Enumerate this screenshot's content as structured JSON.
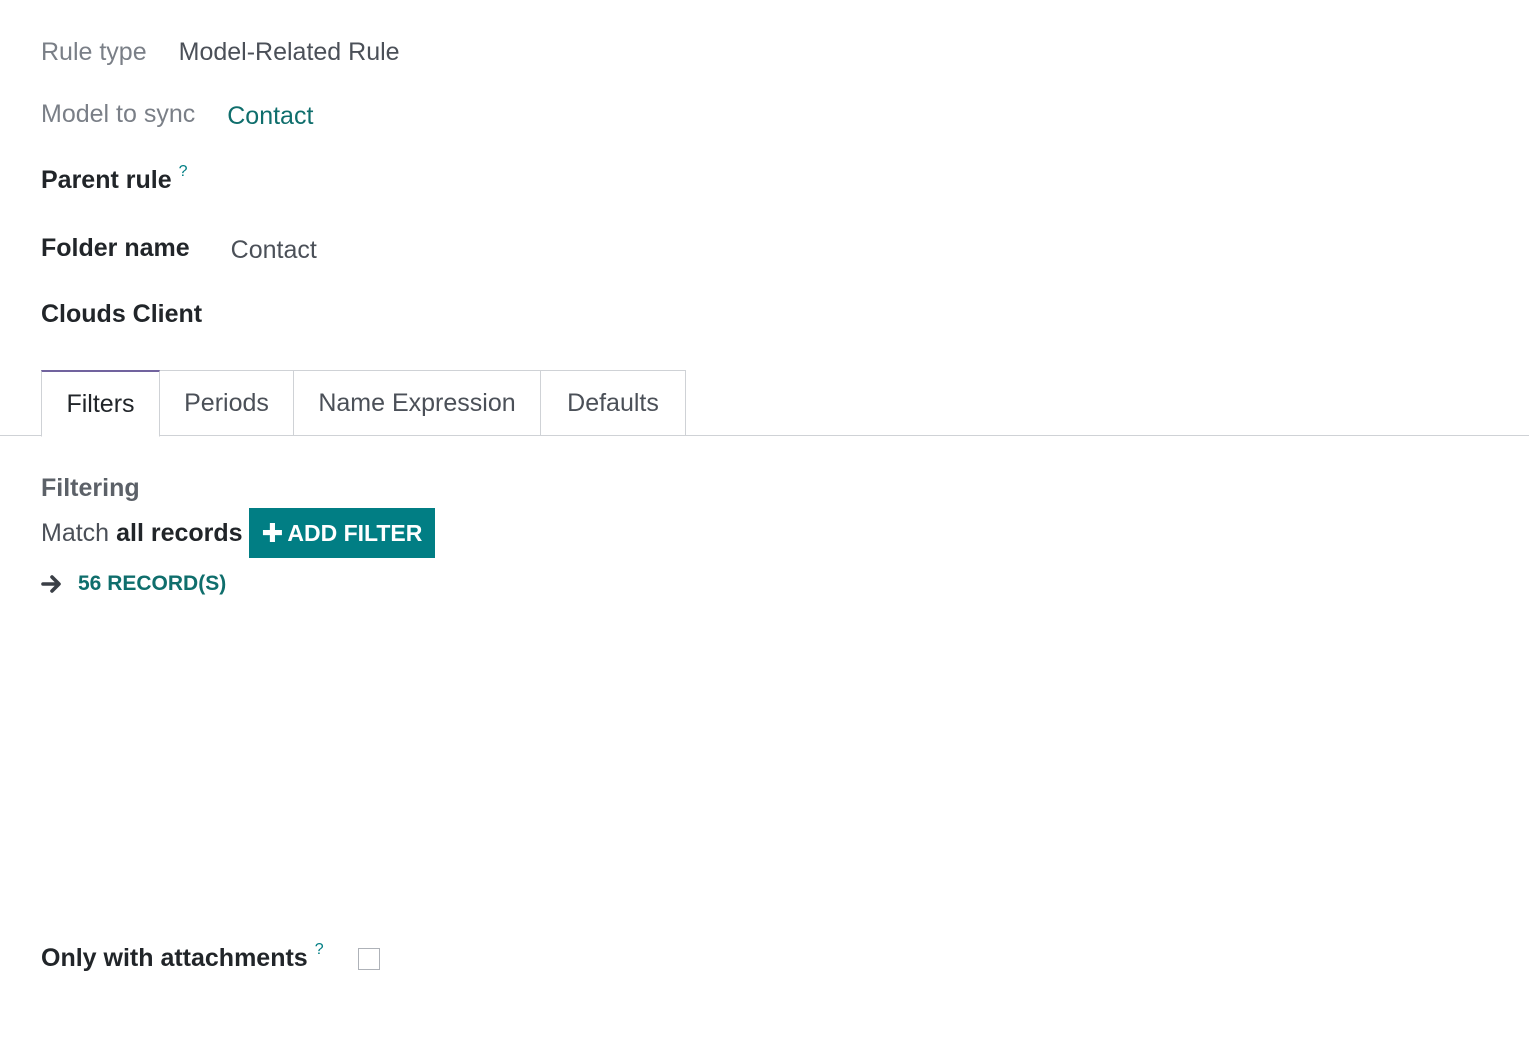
{
  "fields": {
    "rule_type": {
      "label": "Rule type",
      "value": "Model-Related Rule"
    },
    "model_to_sync": {
      "label": "Model to sync",
      "value": "Contact"
    },
    "parent_rule": {
      "label": "Parent rule",
      "help": "?"
    },
    "folder_name": {
      "label": "Folder name",
      "value": "Contact"
    },
    "clouds_client": {
      "label": "Clouds Client"
    }
  },
  "tabs": [
    {
      "label": "Filters",
      "active": true
    },
    {
      "label": "Periods",
      "active": false
    },
    {
      "label": "Name Expression",
      "active": false
    },
    {
      "label": "Defaults",
      "active": false
    }
  ],
  "filtering": {
    "title": "Filtering",
    "match_prefix": "Match",
    "match_scope": "all records",
    "add_filter_label": "ADD FILTER",
    "records_label": "56 RECORD(S)"
  },
  "attachments": {
    "label": "Only with attachments",
    "help": "?",
    "checked": false
  },
  "colors": {
    "accent": "#017e84",
    "link": "#0f6e6c",
    "active_tab": "#71639e"
  }
}
